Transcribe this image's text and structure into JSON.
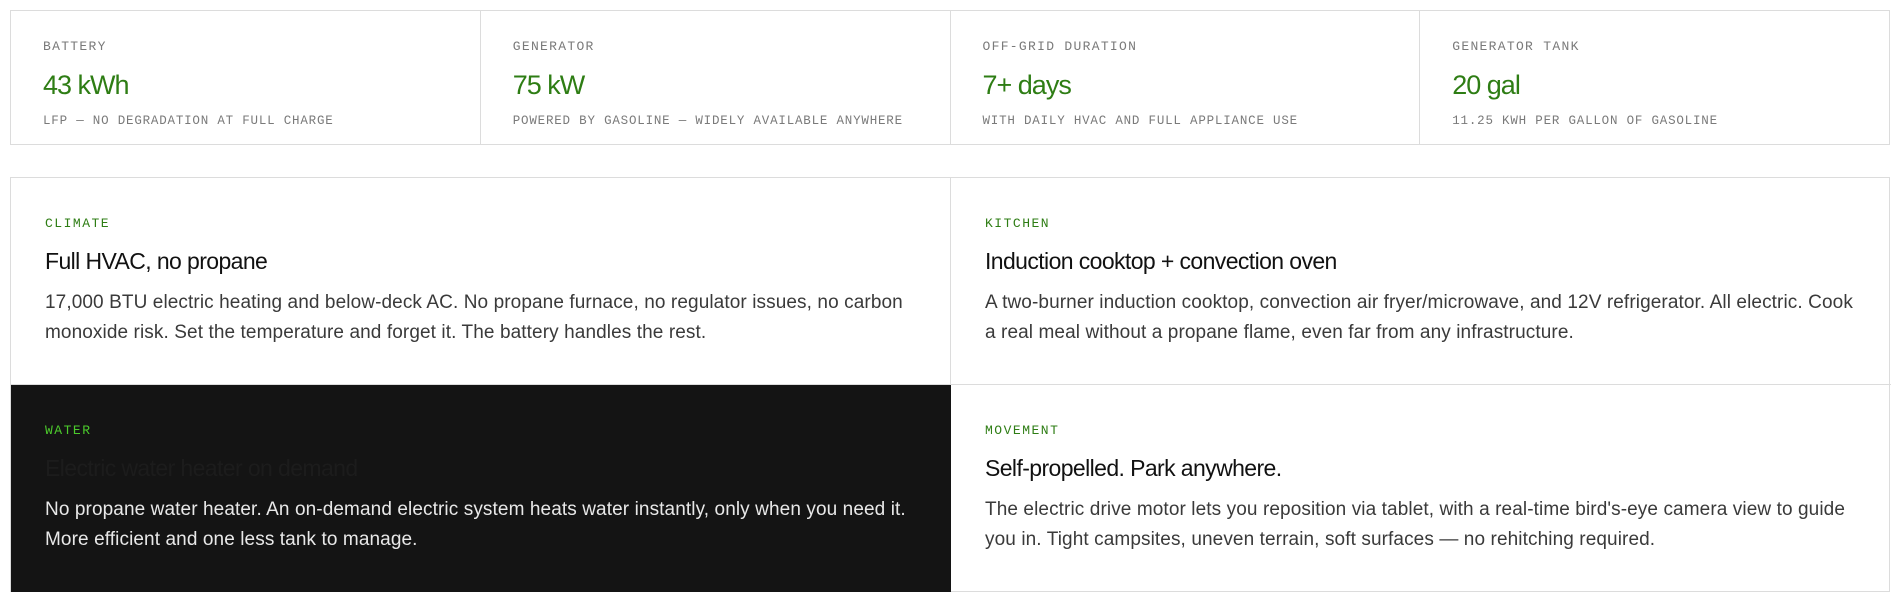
{
  "stats": [
    {
      "label": "BATTERY",
      "value": "43 kWh",
      "sub": "LFP — NO DEGRADATION AT FULL CHARGE"
    },
    {
      "label": "GENERATOR",
      "value": "75 kW",
      "sub": "POWERED BY GASOLINE — WIDELY AVAILABLE ANYWHERE"
    },
    {
      "label": "OFF-GRID DURATION",
      "value": "7+ days",
      "sub": "WITH DAILY HVAC AND FULL APPLIANCE USE"
    },
    {
      "label": "GENERATOR TANK",
      "value": "20 gal",
      "sub": "11.25 KWH PER GALLON OF GASOLINE"
    }
  ],
  "features": [
    {
      "tag": "CLIMATE",
      "title": "Full HVAC, no propane",
      "body": "17,000 BTU electric heating and below-deck AC. No propane furnace, no regulator issues, no carbon monoxide risk. Set the temperature and forget it. The battery handles the rest."
    },
    {
      "tag": "KITCHEN",
      "title": "Induction cooktop + convection oven",
      "body": "A two-burner induction cooktop, convection air fryer/microwave, and 12V refrigerator. All electric. Cook a real meal without a propane flame, even far from any infrastructure."
    },
    {
      "tag": "WATER",
      "title": "Electric water heater on demand",
      "body": "No propane water heater. An on-demand electric system heats water instantly, only when you need it. More efficient and one less tank to manage."
    },
    {
      "tag": "MOVEMENT",
      "title": "Self-propelled. Park anywhere.",
      "body": "The electric drive motor lets you reposition via tablet, with a real-time bird's-eye camera view to guide you in. Tight campsites, uneven terrain, soft surfaces — no rehitching required."
    }
  ],
  "colors": {
    "accent": "#2e7d14",
    "accent_dark_bg": "#4ccb2c",
    "dark_panel": "#141414"
  }
}
